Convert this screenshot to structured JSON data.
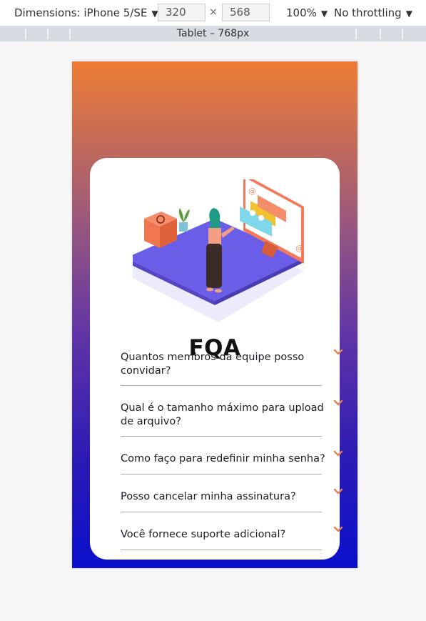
{
  "devtools": {
    "dimensions_label": "Dimensions: iPhone 5/SE",
    "width": "320",
    "height": "568",
    "times": "×",
    "zoom": "100%",
    "throttling": "No throttling",
    "dropdown_arrow": "▼",
    "media_query_label": "Tablet – 768px"
  },
  "faq": {
    "title": "FQA",
    "items": [
      {
        "question": "Quantos membros da equipe posso convidar?"
      },
      {
        "question": "Qual é o tamanho máximo para upload de arquivo?"
      },
      {
        "question": "Como faço para redefinir minha senha?"
      },
      {
        "question": "Posso cancelar minha assinatura?"
      },
      {
        "question": "Você fornece suporte adicional?"
      }
    ]
  },
  "colors": {
    "gradient_top": "#ee7d35",
    "gradient_bottom": "#0a10cc",
    "chevron": "#e8805a",
    "card": "#ffffff"
  },
  "icons": {
    "chevron": "chevron-down-icon",
    "dropdown": "triangle-down"
  }
}
